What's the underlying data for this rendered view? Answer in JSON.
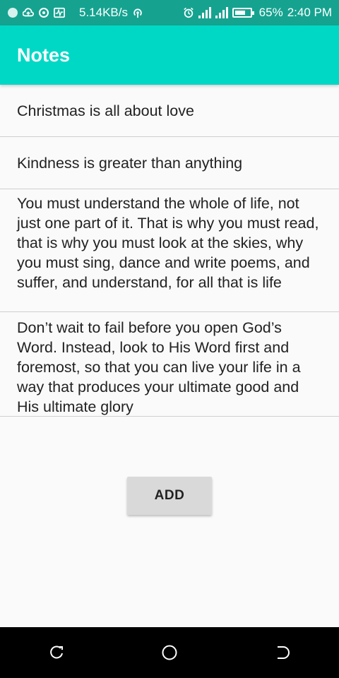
{
  "status_bar": {
    "network_speed": "5.14KB/s",
    "battery_percent": "65%",
    "time": "2:40 PM",
    "icons": [
      "circle-dot-icon",
      "cloud-upload-icon",
      "camera-lens-icon",
      "activity-icon",
      "hotspot-icon",
      "alarm-icon",
      "signal-icon",
      "signal-hplus-icon",
      "battery-icon"
    ]
  },
  "app_bar": {
    "title": "Notes",
    "color": "#00d8c6"
  },
  "notes": [
    "Christmas is all about love",
    "Kindness is greater than anything",
    "You must understand the whole of life, not just one part of it. That is why you must read, that is why you must look at the skies, why you must sing, dance and write poems, and suffer, and understand, for all that is life",
    "Don’t wait to fail before you open God’s Word. Instead, look to His Word first and foremost, so that you can live your life in a way that produces your ultimate good and His ultimate glory"
  ],
  "actions": {
    "add_label": "ADD"
  },
  "nav_bar": {
    "icons": [
      "recent-apps-icon",
      "home-icon",
      "back-icon"
    ]
  }
}
